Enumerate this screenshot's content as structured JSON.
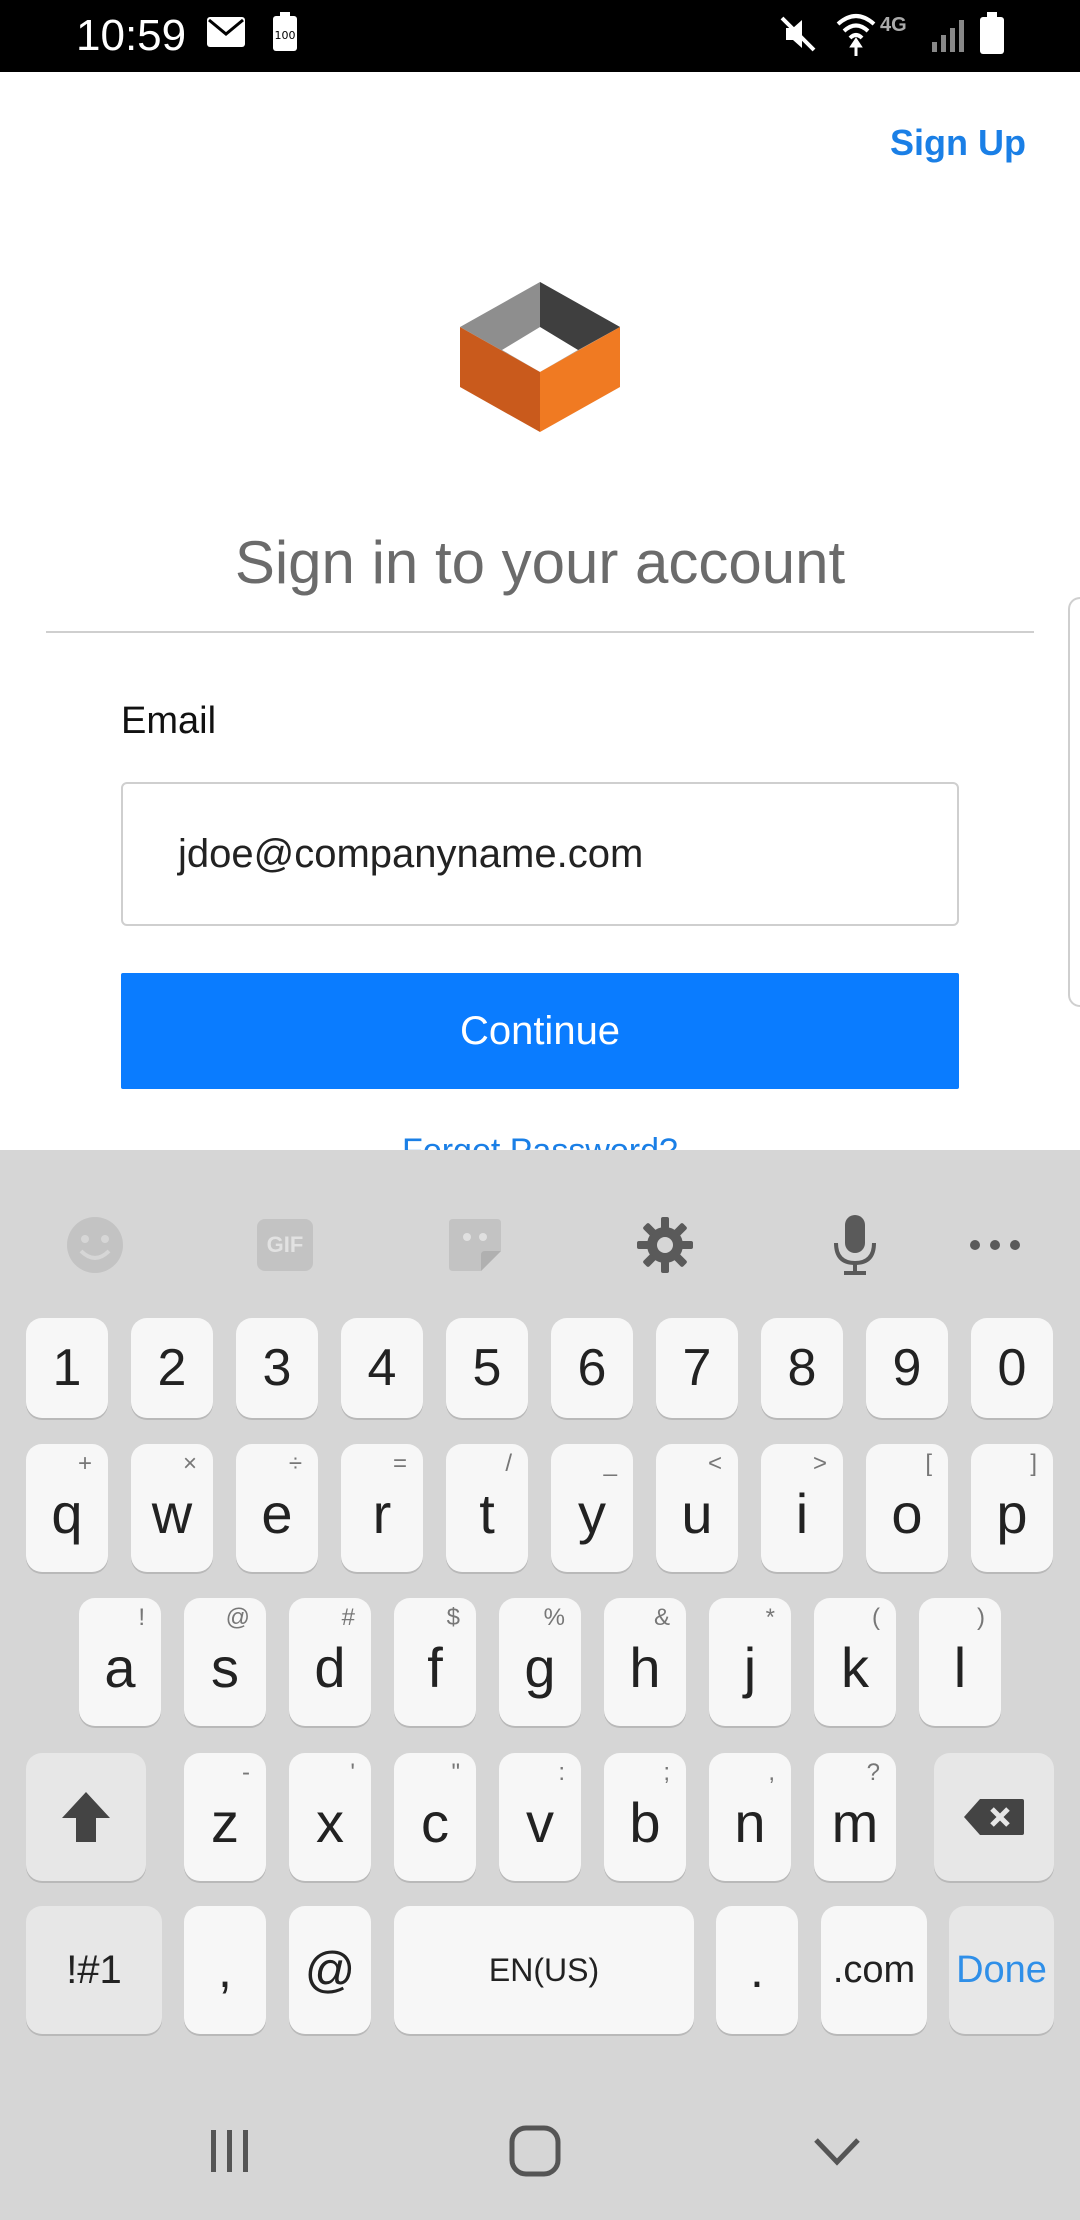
{
  "status_bar": {
    "time": "10:59",
    "icons": [
      "mail-icon",
      "battery-saver-icon",
      "mute-icon",
      "wifi-icon",
      "4g-icon",
      "signal-icon",
      "battery-icon"
    ],
    "network_label": "4G"
  },
  "header": {
    "signup_label": "Sign Up"
  },
  "form": {
    "title": "Sign in to your account",
    "email_label": "Email",
    "email_value": "jdoe@companyname.com",
    "continue_label": "Continue",
    "forgot_label": "Forgot Password?"
  },
  "keyboard": {
    "toolbar": [
      "emoji-icon",
      "gif-icon",
      "sticker-icon",
      "gear-icon",
      "microphone-icon",
      "more-icon"
    ],
    "gif_label": "GIF",
    "row_numbers": [
      "1",
      "2",
      "3",
      "4",
      "5",
      "6",
      "7",
      "8",
      "9",
      "0"
    ],
    "row_q": [
      {
        "k": "q",
        "s": "+"
      },
      {
        "k": "w",
        "s": "×"
      },
      {
        "k": "e",
        "s": "÷"
      },
      {
        "k": "r",
        "s": "="
      },
      {
        "k": "t",
        "s": "/"
      },
      {
        "k": "y",
        "s": "_"
      },
      {
        "k": "u",
        "s": "<"
      },
      {
        "k": "i",
        "s": ">"
      },
      {
        "k": "o",
        "s": "["
      },
      {
        "k": "p",
        "s": "]"
      }
    ],
    "row_a": [
      {
        "k": "a",
        "s": "!"
      },
      {
        "k": "s",
        "s": "@"
      },
      {
        "k": "d",
        "s": "#"
      },
      {
        "k": "f",
        "s": "$"
      },
      {
        "k": "g",
        "s": "%"
      },
      {
        "k": "h",
        "s": "&"
      },
      {
        "k": "j",
        "s": "*"
      },
      {
        "k": "k",
        "s": "("
      },
      {
        "k": "l",
        "s": ")"
      }
    ],
    "row_z": [
      {
        "k": "z",
        "s": "-"
      },
      {
        "k": "x",
        "s": "'"
      },
      {
        "k": "c",
        "s": "\""
      },
      {
        "k": "v",
        "s": ":"
      },
      {
        "k": "b",
        "s": ";"
      },
      {
        "k": "n",
        "s": ","
      },
      {
        "k": "m",
        "s": "?"
      }
    ],
    "symbols_label": "!#1",
    "comma_label": ",",
    "at_label": "@",
    "space_label": "EN(US)",
    "period_label": ".",
    "dotcom_label": ".com",
    "done_label": "Done"
  },
  "colors": {
    "accent": "#0a7cff",
    "link": "#1a7fe6",
    "logo_orange": "#f07a22",
    "logo_gray": "#8e8e8e"
  }
}
